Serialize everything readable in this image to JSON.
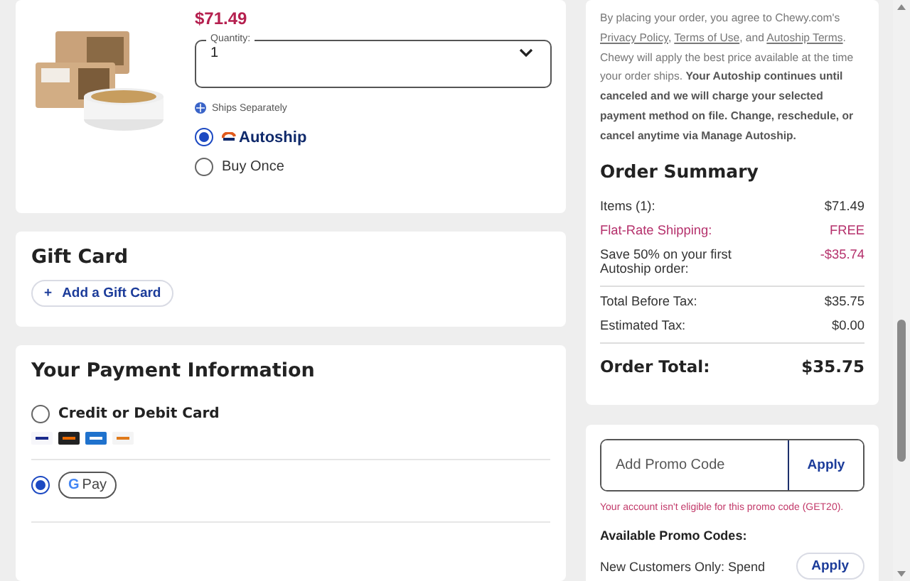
{
  "product": {
    "price": "$71.49",
    "quantity": {
      "label": "Quantity:",
      "value": "1"
    },
    "shipping_note": "Ships Separately",
    "purchase_options": [
      {
        "kind": "autoship",
        "label": "Autoship",
        "selected": true
      },
      {
        "kind": "plain",
        "label": "Buy Once",
        "selected": false
      }
    ]
  },
  "gift_card": {
    "title": "Gift Card",
    "button": {
      "icon": "+",
      "label": "Add a Gift Card"
    }
  },
  "payment": {
    "title": "Your Payment Information",
    "methods": [
      {
        "kind": "card",
        "label": "Credit or Debit Card",
        "selected": false
      },
      {
        "kind": "gpay",
        "logo_letter": "G",
        "label": "Pay",
        "selected": true
      }
    ]
  },
  "legal": [
    {
      "kind": "plain",
      "text": "By placing your order, you agree to Chewy.com's "
    },
    {
      "kind": "link",
      "text": "Privacy Policy"
    },
    {
      "kind": "plain",
      "text": ", "
    },
    {
      "kind": "link",
      "text": "Terms of Use"
    },
    {
      "kind": "plain",
      "text": ", and "
    },
    {
      "kind": "link",
      "text": "Autoship Terms"
    },
    {
      "kind": "plain",
      "text": ". Chewy will apply the best price available at the time your order ships. "
    },
    {
      "kind": "bold",
      "text": "Your Autoship continues until canceled and we will charge your selected payment method on file. Change, reschedule, or cancel anytime via Manage Autoship."
    }
  ],
  "order_summary": {
    "title": "Order Summary",
    "lines": [
      {
        "kind": "normal",
        "label": "Items (1):",
        "value": "$71.49"
      },
      {
        "kind": "highlight",
        "label": "Flat-Rate Shipping:",
        "value": "FREE"
      },
      {
        "kind": "discount",
        "label": "Save 50% on your first Autoship order:",
        "value": "-$35.74"
      },
      {
        "kind": "divider-normal",
        "label": "Total Before Tax:",
        "value": "$35.75"
      },
      {
        "kind": "normal",
        "label": "Estimated Tax:",
        "value": "$0.00"
      }
    ],
    "total": {
      "label": "Order Total:",
      "value": "$35.75"
    }
  },
  "promo": {
    "placeholder": "Add Promo Code",
    "button": "Apply",
    "error": "Your account isn't eligible for this promo code (GET20).",
    "available_title": "Available Promo Codes:",
    "codes": [
      {
        "text": "New Customers Only: Spend",
        "button": "Apply"
      }
    ]
  }
}
